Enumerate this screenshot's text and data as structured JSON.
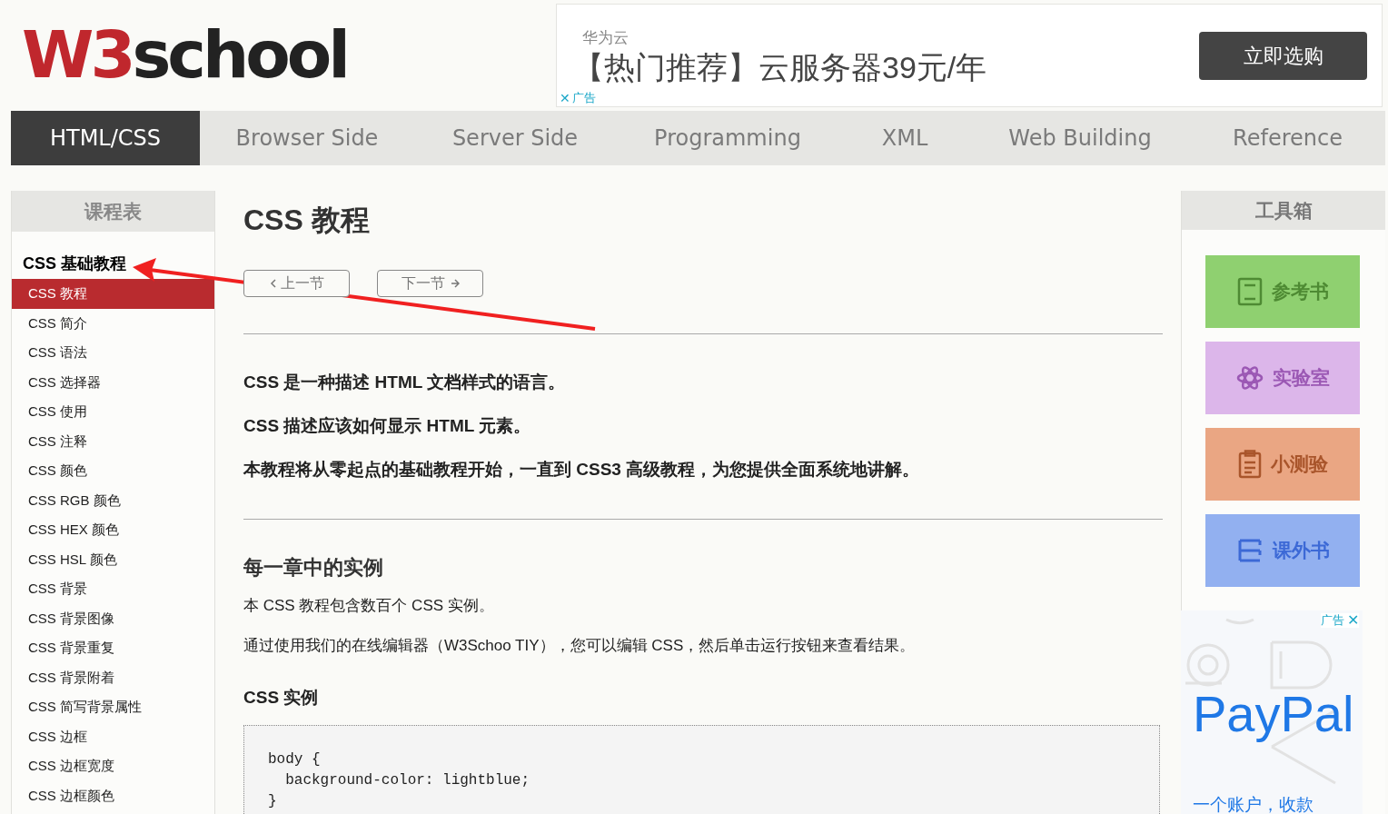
{
  "logo": {
    "mark": "W3",
    "word": "school"
  },
  "top_ad": {
    "brand": "华为云",
    "headline": "【热门推荐】云服务器39元/年",
    "button": "立即选购",
    "close": "✕",
    "ad_label": "广告"
  },
  "nav_tabs": [
    {
      "label": "HTML/CSS",
      "selected": true
    },
    {
      "label": "Browser Side",
      "selected": false
    },
    {
      "label": "Server Side",
      "selected": false
    },
    {
      "label": "Programming",
      "selected": false
    },
    {
      "label": "XML",
      "selected": false
    },
    {
      "label": "Web Building",
      "selected": false
    },
    {
      "label": "Reference",
      "selected": false
    }
  ],
  "left_sidebar": {
    "title": "课程表",
    "section": "CSS 基础教程",
    "items": [
      {
        "label": "CSS 教程",
        "selected": true
      },
      {
        "label": "CSS 简介",
        "selected": false
      },
      {
        "label": "CSS 语法",
        "selected": false
      },
      {
        "label": "CSS 选择器",
        "selected": false
      },
      {
        "label": "CSS 使用",
        "selected": false
      },
      {
        "label": "CSS 注释",
        "selected": false
      },
      {
        "label": "CSS 颜色",
        "selected": false
      },
      {
        "label": "CSS RGB 颜色",
        "selected": false
      },
      {
        "label": "CSS HEX 颜色",
        "selected": false
      },
      {
        "label": "CSS HSL 颜色",
        "selected": false
      },
      {
        "label": "CSS 背景",
        "selected": false
      },
      {
        "label": "CSS 背景图像",
        "selected": false
      },
      {
        "label": "CSS 背景重复",
        "selected": false
      },
      {
        "label": "CSS 背景附着",
        "selected": false
      },
      {
        "label": "CSS 简写背景属性",
        "selected": false
      },
      {
        "label": "CSS 边框",
        "selected": false
      },
      {
        "label": "CSS 边框宽度",
        "selected": false
      },
      {
        "label": "CSS 边框颜色",
        "selected": false
      }
    ]
  },
  "main": {
    "title": "CSS 教程",
    "prev_button": "上一节",
    "next_button": "下一节",
    "intro": [
      "CSS 是一种描述 HTML 文档样式的语言。",
      "CSS 描述应该如何显示 HTML 元素。",
      "本教程将从零起点的基础教程开始，一直到 CSS3 高级教程，为您提供全面系统地讲解。"
    ],
    "section_title": "每一章中的实例",
    "section_text": [
      "本 CSS 教程包含数百个 CSS 实例。",
      "通过使用我们的在线编辑器（W3Schoo TIY），您可以编辑 CSS，然后单击运行按钮来查看结果。"
    ],
    "example_title": "CSS 实例",
    "code_lines": [
      "body {",
      "  background-color: lightblue;",
      "}"
    ]
  },
  "right_sidebar": {
    "title": "工具箱",
    "tools": [
      {
        "label": "参考书",
        "kind": "book",
        "color": "#8fd070"
      },
      {
        "label": "实验室",
        "kind": "atom",
        "color": "#dcb6ea"
      },
      {
        "label": "小测验",
        "kind": "clipboard",
        "color": "#eaa683"
      },
      {
        "label": "课外书",
        "kind": "shelf",
        "color": "#92b0f0"
      }
    ],
    "ad": {
      "ad_label": "广告",
      "close": "✕",
      "brand": "PayPal",
      "tagline": "一个账户，收款"
    }
  }
}
